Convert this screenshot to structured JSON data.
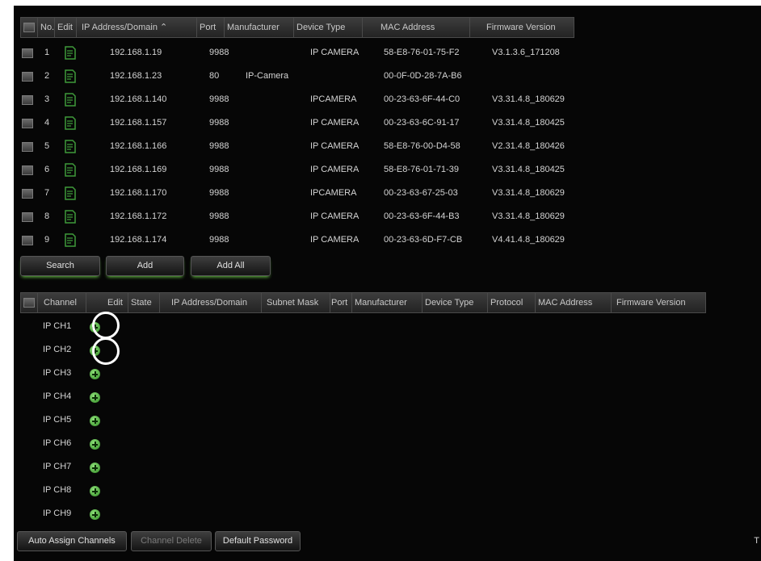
{
  "device_table": {
    "headers": [
      "No.",
      "Edit",
      "IP Address/Domain",
      "Port",
      "Manufacturer",
      "Device Type",
      "MAC Address",
      "Firmware Version"
    ],
    "sort_arrow": "⌃",
    "rows": [
      {
        "no": "1",
        "ip": "192.168.1.19",
        "port": "9988",
        "manufacturer": "",
        "device_type": "IP CAMERA",
        "mac": "58-E8-76-01-75-F2",
        "firmware": "V3.1.3.6_171208"
      },
      {
        "no": "2",
        "ip": "192.168.1.23",
        "port": "80",
        "manufacturer": "IP-Camera",
        "device_type": "",
        "mac": "00-0F-0D-28-7A-B6",
        "firmware": ""
      },
      {
        "no": "3",
        "ip": "192.168.1.140",
        "port": "9988",
        "manufacturer": "",
        "device_type": "IPCAMERA",
        "mac": "00-23-63-6F-44-C0",
        "firmware": "V3.31.4.8_180629"
      },
      {
        "no": "4",
        "ip": "192.168.1.157",
        "port": "9988",
        "manufacturer": "",
        "device_type": "IP CAMERA",
        "mac": "00-23-63-6C-91-17",
        "firmware": "V3.31.4.8_180425"
      },
      {
        "no": "5",
        "ip": "192.168.1.166",
        "port": "9988",
        "manufacturer": "",
        "device_type": "IP CAMERA",
        "mac": "58-E8-76-00-D4-58",
        "firmware": "V2.31.4.8_180426"
      },
      {
        "no": "6",
        "ip": "192.168.1.169",
        "port": "9988",
        "manufacturer": "",
        "device_type": "IP CAMERA",
        "mac": "58-E8-76-01-71-39",
        "firmware": "V3.31.4.8_180425"
      },
      {
        "no": "7",
        "ip": "192.168.1.170",
        "port": "9988",
        "manufacturer": "",
        "device_type": "IPCAMERA",
        "mac": "00-23-63-67-25-03",
        "firmware": "V3.31.4.8_180629"
      },
      {
        "no": "8",
        "ip": "192.168.1.172",
        "port": "9988",
        "manufacturer": "",
        "device_type": "IP CAMERA",
        "mac": "00-23-63-6F-44-B3",
        "firmware": "V3.31.4.8_180629"
      },
      {
        "no": "9",
        "ip": "192.168.1.174",
        "port": "9988",
        "manufacturer": "",
        "device_type": "IP CAMERA",
        "mac": "00-23-63-6D-F7-CB",
        "firmware": "V4.41.4.8_180629"
      }
    ]
  },
  "device_buttons": {
    "search": "Search",
    "add": "Add",
    "add_all": "Add All"
  },
  "channel_table": {
    "headers": [
      "Channel",
      "Edit",
      "State",
      "IP Address/Domain",
      "Subnet Mask",
      "Port",
      "Manufacturer",
      "Device Type",
      "Protocol",
      "MAC Address",
      "Firmware Version"
    ],
    "channels": [
      "IP CH1",
      "IP CH2",
      "IP CH3",
      "IP CH4",
      "IP CH5",
      "IP CH6",
      "IP CH7",
      "IP CH8",
      "IP CH9"
    ]
  },
  "bottom_buttons": {
    "auto_assign": "Auto Assign Channels",
    "channel_delete": "Channel Delete",
    "default_password": "Default Password"
  },
  "trailing_text": "T",
  "colors": {
    "background": "#060606",
    "header": "#2e2e2e",
    "text": "#d4d4d4",
    "add_icon": "#3fa52d",
    "highlight_ring": "#ffffff"
  }
}
